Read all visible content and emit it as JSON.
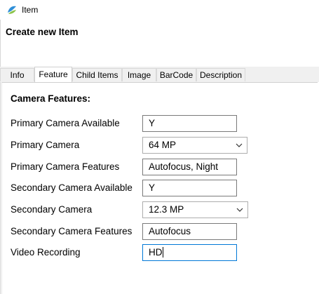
{
  "window": {
    "title": "Item",
    "icon": "app-icon"
  },
  "header": {
    "title": "Create new Item"
  },
  "tabs": [
    {
      "label": "Info",
      "active": false
    },
    {
      "label": "Feature",
      "active": true
    },
    {
      "label": "Child Items",
      "active": false
    },
    {
      "label": "Image",
      "active": false
    },
    {
      "label": "BarCode",
      "active": false
    },
    {
      "label": "Description",
      "active": false
    }
  ],
  "section": {
    "title": "Camera Features:"
  },
  "fields": {
    "primary_camera_available": {
      "label": "Primary Camera Available",
      "value": "Y"
    },
    "primary_camera": {
      "label": "Primary Camera",
      "value": "64 MP",
      "icon": "chevron-down-icon"
    },
    "primary_camera_features": {
      "label": "Primary Camera Features",
      "value": "Autofocus, Night"
    },
    "secondary_camera_available": {
      "label": "Secondary Camera Available",
      "value": "Y"
    },
    "secondary_camera": {
      "label": "Secondary Camera",
      "value": "12.3 MP",
      "icon": "chevron-down-icon"
    },
    "secondary_camera_features": {
      "label": "Secondary Camera Features",
      "value": "Autofocus"
    },
    "video_recording": {
      "label": "Video Recording",
      "value": "HD",
      "focused": true
    }
  },
  "colors": {
    "focus_border": "#0078d7",
    "tab_strip": "#f0f0f0"
  }
}
